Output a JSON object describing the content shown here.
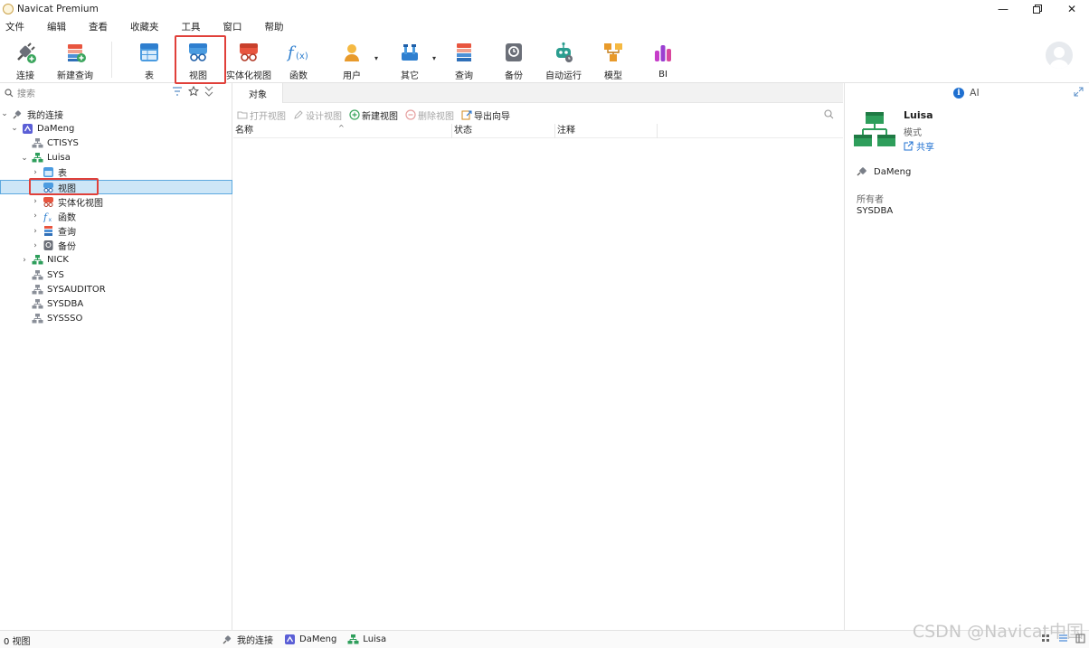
{
  "window": {
    "title": "Navicat Premium",
    "controls": [
      "minimize",
      "maximize",
      "close"
    ]
  },
  "menu": [
    "文件",
    "编辑",
    "查看",
    "收藏夹",
    "工具",
    "窗口",
    "帮助"
  ],
  "toolbar": {
    "connect": "连接",
    "new_query": "新建查询",
    "table": "表",
    "view": "视图",
    "materialized_view": "实体化视图",
    "function": "函数",
    "user": "用户",
    "other": "其它",
    "query": "查询",
    "backup": "备份",
    "automation": "自动运行",
    "model": "模型",
    "bi": "BI",
    "active": "视图"
  },
  "search": {
    "placeholder": "搜索"
  },
  "tree": {
    "root": "我的连接",
    "connection": "DaMeng",
    "schemas": {
      "ctisys": "CTISYS",
      "luisa": "Luisa",
      "nick": "NICK",
      "sys": "SYS",
      "sysauditor": "SYSAUDITOR",
      "sysdba": "SYSDBA",
      "syssso": "SYSSSO"
    },
    "luisa_children": {
      "table": "表",
      "view": "视图",
      "mview": "实体化视图",
      "function": "函数",
      "query": "查询",
      "backup": "备份"
    },
    "selected": "视图"
  },
  "center": {
    "tab": "对象",
    "actions": {
      "open_view": "打开视图",
      "design_view": "设计视图",
      "new_view": "新建视图",
      "delete_view": "删除视图",
      "export_wizard": "导出向导"
    },
    "columns": {
      "name": "名称",
      "status": "状态",
      "comment": "注释"
    }
  },
  "right": {
    "ai": "AI",
    "object_name": "Luisa",
    "object_type": "模式",
    "share": "共享",
    "connection": "DaMeng",
    "owner_label": "所有者",
    "owner_value": "SYSDBA"
  },
  "status": {
    "count": "0 视图",
    "crumbs": {
      "c1": "我的连接",
      "c2": "DaMeng",
      "c3": "Luisa"
    },
    "watermark": "CSDN @Navicat中国"
  },
  "colors": {
    "accent": "#1e6fd0",
    "highlight": "#e0403a",
    "selection": "#cde6f7"
  }
}
